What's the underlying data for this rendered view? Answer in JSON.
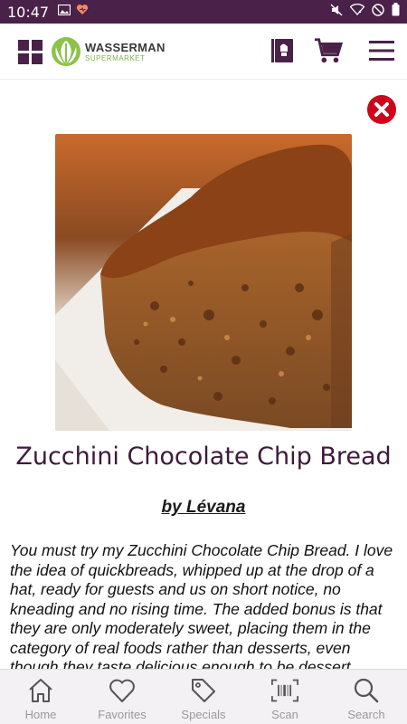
{
  "status_bar": {
    "time": "10:47",
    "left_icons": [
      "image-icon",
      "heart-badge-icon"
    ],
    "right_icons": [
      "mute-icon",
      "wifi-icon",
      "do-not-disturb-icon",
      "battery-icon"
    ],
    "background": "#4a2148"
  },
  "header": {
    "logo_name": "WASSERMAN",
    "logo_sub": "SUPERMARKET",
    "icons": [
      "grid-icon",
      "recipe-book-icon",
      "cart-icon",
      "menu-icon"
    ],
    "brand_color": "#4a2148",
    "logo_green": "#7cb342"
  },
  "recipe": {
    "title": "Zucchini Chocolate Chip Bread",
    "author": "by Lévana",
    "description": "You must try my Zucchini Chocolate Chip Bread. I love the idea of quickbreads, whipped up at the drop of a hat, ready for guests and us on short notice, no kneading and no rising time. The added bonus is that they are only moderately sweet, placing them in the category of real foods rather than desserts, even though they taste delicious enough to be dessert."
  },
  "close_color": "#d0021b",
  "bottom_nav": {
    "items": [
      {
        "label": "Home",
        "icon": "home-icon"
      },
      {
        "label": "Favorites",
        "icon": "heart-icon"
      },
      {
        "label": "Specials",
        "icon": "tag-icon"
      },
      {
        "label": "Scan",
        "icon": "barcode-icon"
      },
      {
        "label": "Search",
        "icon": "search-icon"
      }
    ]
  }
}
